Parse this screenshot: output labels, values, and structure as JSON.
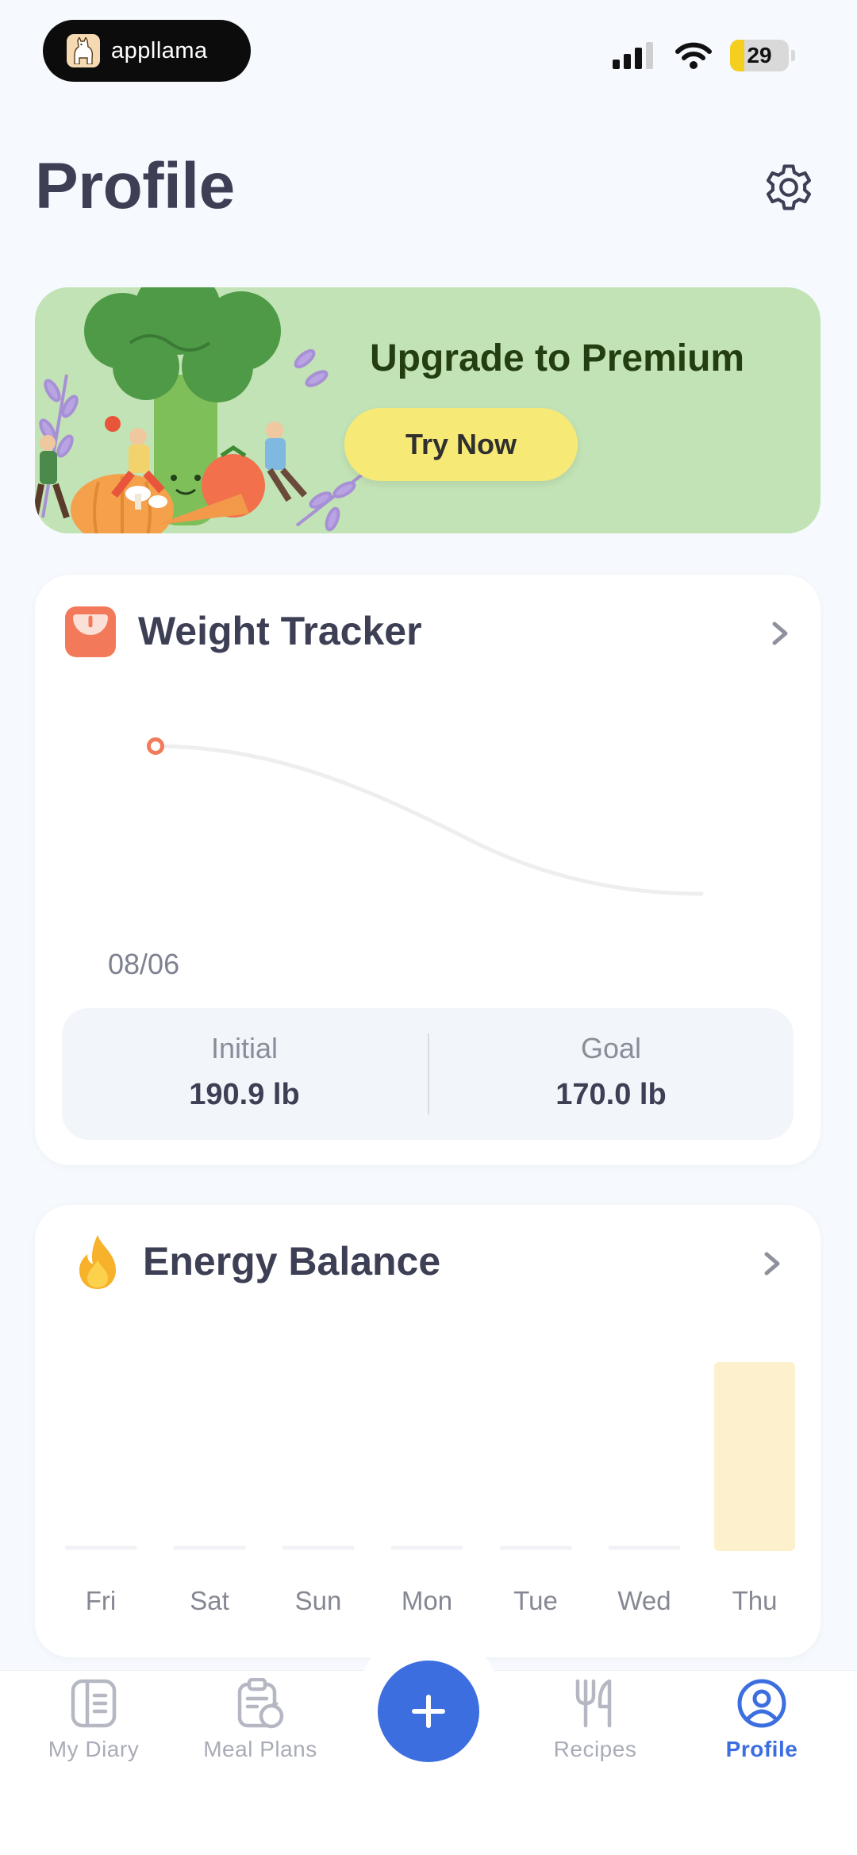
{
  "status_bar": {
    "brand": "appllama",
    "battery": "29"
  },
  "header": {
    "title": "Profile"
  },
  "banner": {
    "title": "Upgrade to Premium",
    "cta": "Try Now"
  },
  "weight_tracker": {
    "title": "Weight Tracker",
    "date_label": "08/06",
    "initial_label": "Initial",
    "initial_value": "190.9 lb",
    "goal_label": "Goal",
    "goal_value": "170.0 lb"
  },
  "energy_balance": {
    "title": "Energy Balance",
    "days": [
      "Fri",
      "Sat",
      "Sun",
      "Mon",
      "Tue",
      "Wed",
      "Thu"
    ]
  },
  "nav": {
    "items": [
      {
        "label": "My Diary"
      },
      {
        "label": "Meal Plans"
      },
      {
        "label": "Recipes"
      },
      {
        "label": "Profile"
      }
    ]
  },
  "colors": {
    "accent": "#3c6ee0",
    "banner_bg": "#c2e3b5",
    "cta_bg": "#f7e976",
    "weight_marker": "#f27a5a",
    "energy_bar": "#fdf0cd"
  }
}
